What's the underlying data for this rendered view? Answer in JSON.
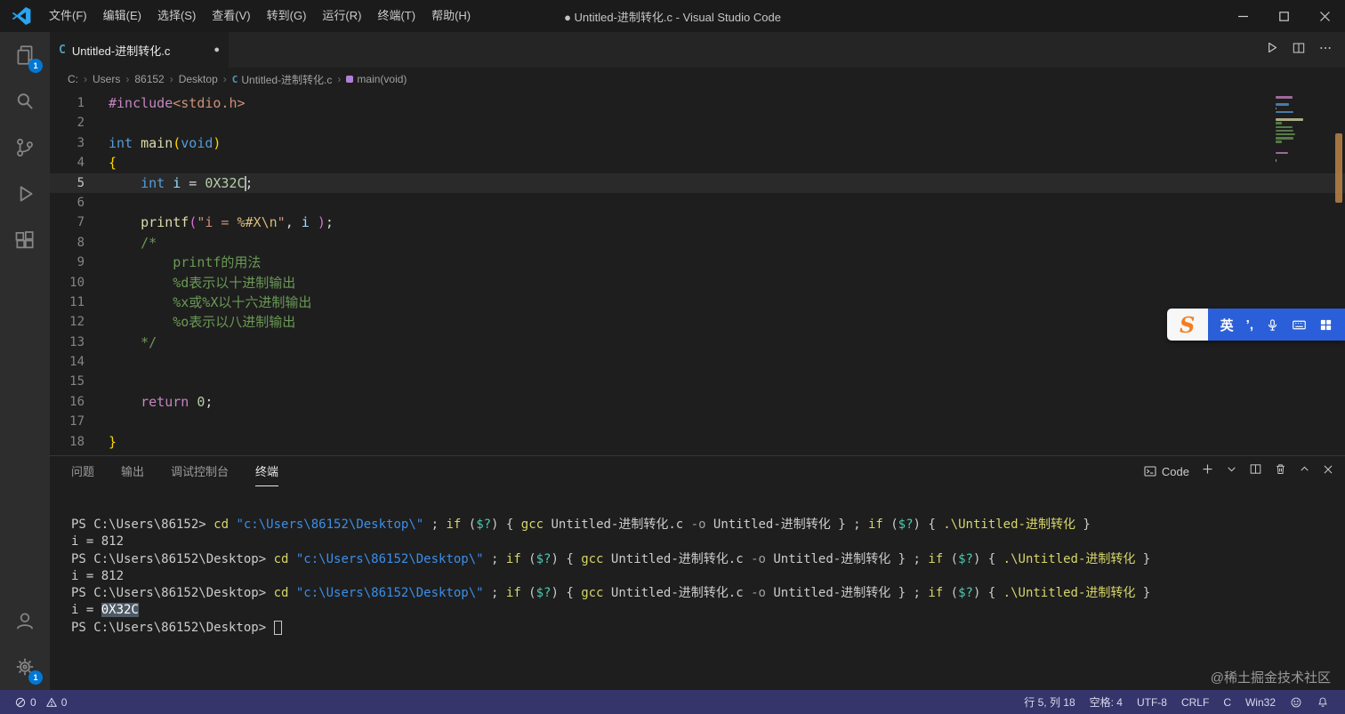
{
  "colors": {
    "accent": "#0078d4",
    "status-bg": "#35356b",
    "ime-blue": "#2b5fd9",
    "ime-orange": "#f57d1f"
  },
  "title_bar": {
    "title": "● Untitled-进制转化.c - Visual Studio Code",
    "menus": [
      "文件(F)",
      "编辑(E)",
      "选择(S)",
      "查看(V)",
      "转到(G)",
      "运行(R)",
      "终端(T)",
      "帮助(H)"
    ]
  },
  "activity_bar": {
    "explorer_badge": "1",
    "settings_badge": "1"
  },
  "editor": {
    "tab": {
      "icon": "C",
      "label": "Untitled-进制转化.c",
      "dirty": "●"
    },
    "breadcrumb": [
      {
        "label": "C:"
      },
      {
        "label": "Users"
      },
      {
        "label": "86152"
      },
      {
        "label": "Desktop"
      },
      {
        "label": "Untitled-进制转化.c",
        "icon": "c-file"
      },
      {
        "label": "main(void)",
        "icon": "symbol-method"
      }
    ],
    "cursor_line": 5,
    "lines": [
      [
        [
          "macro",
          "#include"
        ],
        [
          "str",
          "<stdio.h>"
        ]
      ],
      [],
      [
        [
          "kw",
          "int"
        ],
        [
          "plain",
          " "
        ],
        [
          "fn",
          "main"
        ],
        [
          "b1",
          "("
        ],
        [
          "kw",
          "void"
        ],
        [
          "b1",
          ")"
        ]
      ],
      [
        [
          "b1",
          "{"
        ]
      ],
      [
        [
          "plain",
          "    "
        ],
        [
          "kw",
          "int"
        ],
        [
          "plain",
          " "
        ],
        [
          "var",
          "i"
        ],
        [
          "plain",
          " = "
        ],
        [
          "num",
          "0X32C"
        ],
        [
          "cursor",
          ""
        ],
        [
          "plain",
          ";"
        ]
      ],
      [],
      [
        [
          "plain",
          "    "
        ],
        [
          "fn",
          "printf"
        ],
        [
          "b2",
          "("
        ],
        [
          "str",
          "\"i = "
        ],
        [
          "esc",
          "%#X"
        ],
        [
          "esc",
          "\\n"
        ],
        [
          "str",
          "\""
        ],
        [
          "plain",
          ", "
        ],
        [
          "var",
          "i"
        ],
        [
          "plain",
          " "
        ],
        [
          "b2",
          ")"
        ],
        [
          "plain",
          ";"
        ]
      ],
      [
        [
          "comment",
          "    /*"
        ]
      ],
      [
        [
          "comment",
          "        printf的用法"
        ]
      ],
      [
        [
          "comment",
          "        %d表示以十进制输出"
        ]
      ],
      [
        [
          "comment",
          "        %x或%X以十六进制输出"
        ]
      ],
      [
        [
          "comment",
          "        %o表示以八进制输出"
        ]
      ],
      [
        [
          "comment",
          "    */"
        ]
      ],
      [],
      [],
      [
        [
          "plain",
          "    "
        ],
        [
          "ret",
          "return"
        ],
        [
          "plain",
          " "
        ],
        [
          "num",
          "0"
        ],
        [
          "plain",
          ";"
        ]
      ],
      [],
      [
        [
          "b1",
          "}"
        ]
      ]
    ]
  },
  "panel": {
    "tabs": [
      {
        "label": "问题",
        "active": false
      },
      {
        "label": "输出",
        "active": false
      },
      {
        "label": "调试控制台",
        "active": false
      },
      {
        "label": "终端",
        "active": true
      }
    ],
    "profile_label": "Code"
  },
  "terminal": {
    "lines": [
      [
        [
          "tplain",
          "PS C:\\Users\\86152> "
        ],
        [
          "tcmd",
          "cd"
        ],
        [
          "tplain",
          " "
        ],
        [
          "tstr",
          "\"c:\\Users\\86152\\Desktop\\\""
        ],
        [
          "tplain",
          " ; "
        ],
        [
          "tcmd",
          "if"
        ],
        [
          "tplain",
          " ("
        ],
        [
          "tvar",
          "$?"
        ],
        [
          "tplain",
          ") { "
        ],
        [
          "tcmd",
          "gcc"
        ],
        [
          "tplain",
          " Untitled-进制转化.c "
        ],
        [
          "tparam",
          "-o"
        ],
        [
          "tplain",
          " Untitled-进制转化 } ; "
        ],
        [
          "tcmd",
          "if"
        ],
        [
          "tplain",
          " ("
        ],
        [
          "tvar",
          "$?"
        ],
        [
          "tplain",
          ") { "
        ],
        [
          "tcmd",
          ".\\Untitled-进制转化"
        ],
        [
          "tplain",
          " }"
        ]
      ],
      [
        [
          "tplain",
          "i = 812"
        ]
      ],
      [
        [
          "tplain",
          "PS C:\\Users\\86152\\Desktop> "
        ],
        [
          "tcmd",
          "cd"
        ],
        [
          "tplain",
          " "
        ],
        [
          "tstr",
          "\"c:\\Users\\86152\\Desktop\\\""
        ],
        [
          "tplain",
          " ; "
        ],
        [
          "tcmd",
          "if"
        ],
        [
          "tplain",
          " ("
        ],
        [
          "tvar",
          "$?"
        ],
        [
          "tplain",
          ") { "
        ],
        [
          "tcmd",
          "gcc"
        ],
        [
          "tplain",
          " Untitled-进制转化.c "
        ],
        [
          "tparam",
          "-o"
        ],
        [
          "tplain",
          " Untitled-进制转化 } ; "
        ],
        [
          "tcmd",
          "if"
        ],
        [
          "tplain",
          " ("
        ],
        [
          "tvar",
          "$?"
        ],
        [
          "tplain",
          ") { "
        ],
        [
          "tcmd",
          ".\\Untitled-进制转化"
        ],
        [
          "tplain",
          " }"
        ]
      ],
      [
        [
          "tplain",
          "i = 812"
        ]
      ],
      [
        [
          "tplain",
          "PS C:\\Users\\86152\\Desktop> "
        ],
        [
          "tcmd",
          "cd"
        ],
        [
          "tplain",
          " "
        ],
        [
          "tstr",
          "\"c:\\Users\\86152\\Desktop\\\""
        ],
        [
          "tplain",
          " ; "
        ],
        [
          "tcmd",
          "if"
        ],
        [
          "tplain",
          " ("
        ],
        [
          "tvar",
          "$?"
        ],
        [
          "tplain",
          ") { "
        ],
        [
          "tcmd",
          "gcc"
        ],
        [
          "tplain",
          " Untitled-进制转化.c "
        ],
        [
          "tparam",
          "-o"
        ],
        [
          "tplain",
          " Untitled-进制转化 } ; "
        ],
        [
          "tcmd",
          "if"
        ],
        [
          "tplain",
          " ("
        ],
        [
          "tvar",
          "$?"
        ],
        [
          "tplain",
          ") { "
        ],
        [
          "tcmd",
          ".\\Untitled-进制转化"
        ],
        [
          "tplain",
          " }"
        ]
      ],
      [
        [
          "tplain",
          "i = "
        ],
        [
          "tsel",
          "0X32C"
        ]
      ],
      [
        [
          "tplain",
          "PS C:\\Users\\86152\\Desktop> "
        ],
        [
          "tcursor",
          ""
        ]
      ]
    ]
  },
  "status_bar": {
    "errors": "0",
    "warnings": "0",
    "items": [
      "行 5, 列 18",
      "空格: 4",
      "UTF-8",
      "CRLF",
      "C",
      "Win32"
    ]
  },
  "ime": {
    "logo": "S",
    "lang": "英",
    "punct": "’,"
  },
  "watermark": "@稀土掘金技术社区"
}
